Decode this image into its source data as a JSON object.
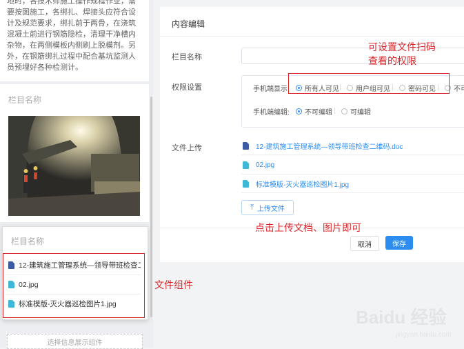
{
  "left": {
    "text_card": {
      "text": "地时，各技术师施工操作规程作业，需要按图施工，各绑扎、焊接头应符合设计及规范要求，绑扎前于两骨，在浇筑混凝土前进行钢筋隐检，清理干净槽内杂物，在两侧模板内侧刷上脱模剂。另外，在钢筋绑扎过程中配合基坑监测人员预埋好各种检测计。"
    },
    "photo_card": {
      "title": "栏目名称"
    },
    "file_card": {
      "title": "栏目名称",
      "files": [
        {
          "name": "12-建筑施工管理系统—领导带班检查二...",
          "type": "doc-icon"
        },
        {
          "name": "02.jpg",
          "type": "image-icon"
        },
        {
          "name": "标准模版-灭火器巡检图片1.jpg",
          "type": "image-icon"
        }
      ]
    },
    "bottom_card": {
      "text": "选择信息展示组件"
    }
  },
  "editor": {
    "title": "内容编辑",
    "column_name_label": "栏目名称",
    "column_name_value": "",
    "permission_label": "权限设置",
    "mobile_display_label": "手机端显示:",
    "display_options": [
      "所有人可见",
      "用户组可见",
      "密码可见",
      "不可"
    ],
    "display_selected": 0,
    "mobile_edit_label": "手机端编辑:",
    "edit_options": [
      "不可编辑",
      "可编辑"
    ],
    "edit_selected": 0,
    "upload_label": "文件上传",
    "files": [
      {
        "name": "12-建筑施工管理系统—领导带班检查二维码.doc",
        "type": "doc-icon"
      },
      {
        "name": "02.jpg",
        "type": "image-icon"
      },
      {
        "name": "标准模版-灭火器巡检图片1.jpg",
        "type": "image-icon"
      }
    ],
    "upload_button": "上传文件",
    "cancel_button": "取消",
    "save_button": "保存"
  },
  "annotations": {
    "permission_note_1": "可设置文件扫码",
    "permission_note_2": "查看的权限",
    "upload_note": "点击上传文档、图片即可",
    "file_component_note": "文件组件",
    "color": "#d9262b"
  },
  "watermark": {
    "main": "Baidu 经验",
    "sub": "jingyan.baidu.com"
  },
  "colors": {
    "primary": "#2d8cf0",
    "annotation": "#d9262b"
  }
}
